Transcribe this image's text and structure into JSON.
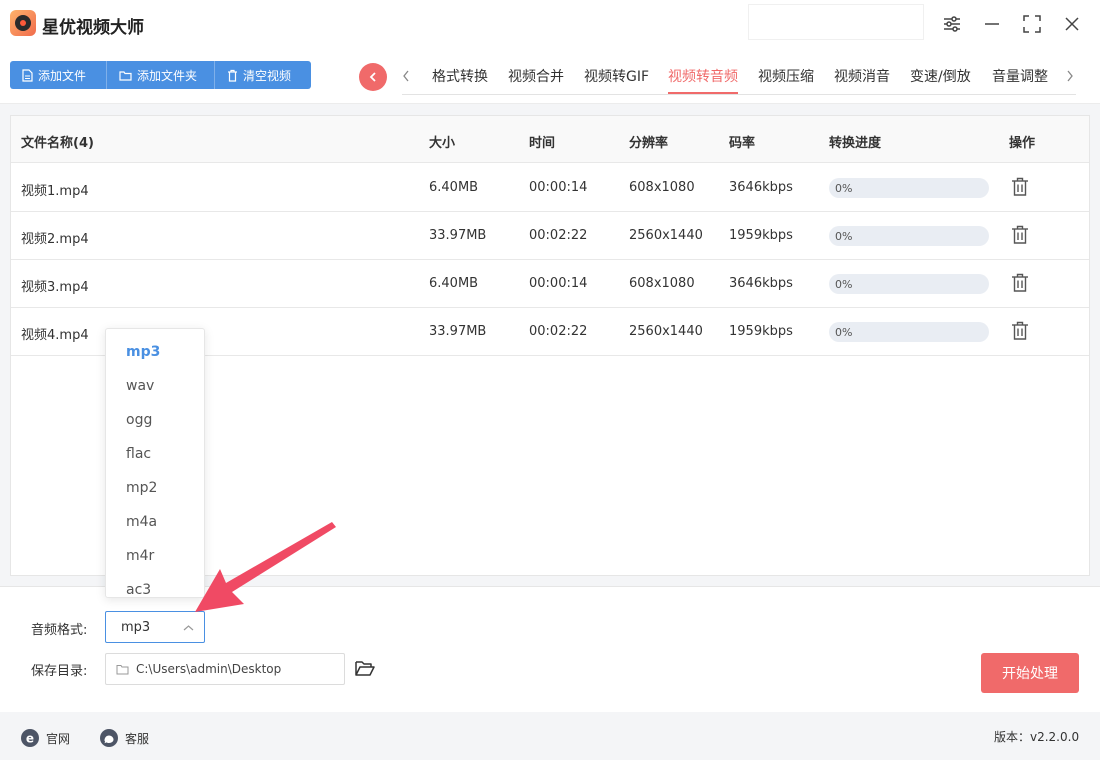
{
  "app": {
    "title": "星优视频大师"
  },
  "toolbar": {
    "add_file": "添加文件",
    "add_folder": "添加文件夹",
    "clear": "清空视频"
  },
  "tabs": [
    "格式转换",
    "视频合并",
    "视频转GIF",
    "视频转音频",
    "视频压缩",
    "视频消音",
    "变速/倒放",
    "音量调整"
  ],
  "active_tab": "视频转音频",
  "table": {
    "headers": [
      "文件名称(4)",
      "大小",
      "时间",
      "分辨率",
      "码率",
      "转换进度",
      "操作"
    ],
    "rows": [
      {
        "name": "视频1.mp4",
        "size": "6.40MB",
        "time": "00:00:14",
        "res": "608x1080",
        "bitrate": "3646kbps",
        "progress": "0%"
      },
      {
        "name": "视频2.mp4",
        "size": "33.97MB",
        "time": "00:02:22",
        "res": "2560x1440",
        "bitrate": "1959kbps",
        "progress": "0%"
      },
      {
        "name": "视频3.mp4",
        "size": "6.40MB",
        "time": "00:00:14",
        "res": "608x1080",
        "bitrate": "3646kbps",
        "progress": "0%"
      },
      {
        "name": "视频4.mp4",
        "size": "33.97MB",
        "time": "00:02:22",
        "res": "2560x1440",
        "bitrate": "1959kbps",
        "progress": "0%"
      }
    ]
  },
  "dropdown": {
    "options": [
      "mp3",
      "wav",
      "ogg",
      "flac",
      "mp2",
      "m4a",
      "m4r",
      "ac3"
    ],
    "selected": "mp3"
  },
  "settings": {
    "format_label": "音频格式:",
    "format_value": "mp3",
    "dir_label": "保存目录:",
    "dir_value": "C:\\Users\\admin\\Desktop",
    "start": "开始处理"
  },
  "status": {
    "website": "官网",
    "service": "客服",
    "version": "版本：v2.2.0.0"
  },
  "colors": {
    "accent_blue": "#4a90e2",
    "accent_red": "#f06a6a",
    "arrow": "#f04a64"
  }
}
